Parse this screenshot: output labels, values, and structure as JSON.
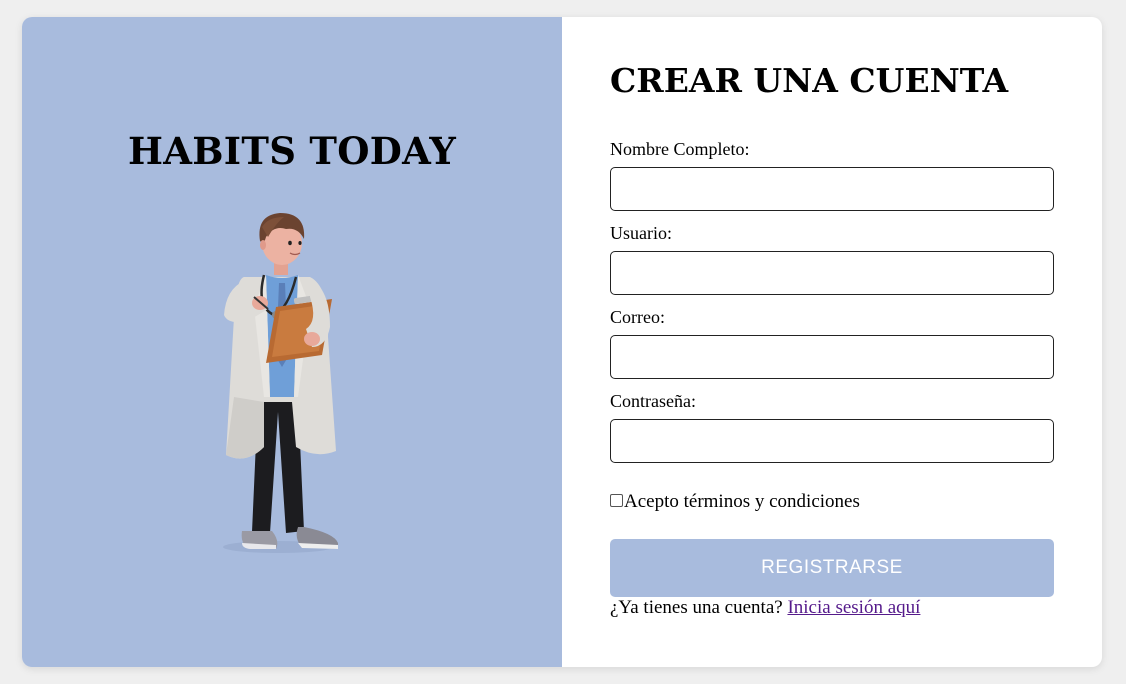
{
  "brand": {
    "title": "HABITS TODAY",
    "illustration": "doctor-with-clipboard"
  },
  "form": {
    "title": "CREAR UNA CUENTA",
    "fields": [
      {
        "label": "Nombre Completo:",
        "value": "",
        "placeholder": ""
      },
      {
        "label": "Usuario:",
        "value": "",
        "placeholder": ""
      },
      {
        "label": "Correo:",
        "value": "",
        "placeholder": ""
      },
      {
        "label": "Contraseña:",
        "value": "",
        "placeholder": ""
      }
    ],
    "terms": {
      "label": "Acepto términos y condiciones",
      "checked": false
    },
    "submit_label": "REGISTRARSE",
    "login_prompt": "¿Ya tienes una cuenta?",
    "login_link": "Inicia sesión aquí"
  },
  "colors": {
    "accent": "#a8bbdd",
    "link": "#551a8b",
    "background": "#efefef"
  }
}
